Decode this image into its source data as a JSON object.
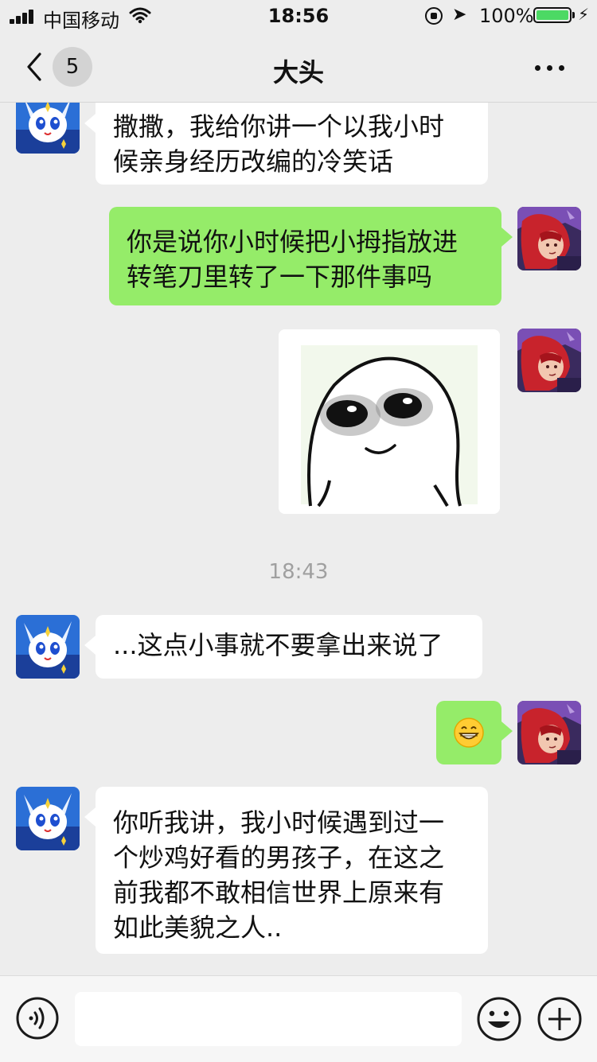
{
  "status_bar": {
    "carrier": "中国移动",
    "time": "18:56",
    "battery_percent": "100%",
    "battery_level": 1.0
  },
  "nav": {
    "unread_count": "5",
    "title": "大头"
  },
  "messages": [
    {
      "from": "friend",
      "avatar": "friend-avatar",
      "lines": [
        "撒撒，我给你讲一个以我小时",
        "候亲身经历改编的冷笑话"
      ]
    },
    {
      "from": "me",
      "avatar": "my-avatar",
      "lines": [
        "你是说你小时候把小拇指放进",
        "转笔刀里转了一下那件事吗"
      ]
    },
    {
      "from": "me",
      "avatar": "my-avatar",
      "sticker": "smiling-blob-sticker"
    },
    {
      "timestamp": "18:43"
    },
    {
      "from": "friend",
      "avatar": "friend-avatar",
      "lines": [
        "...这点小事就不要拿出来说了"
      ]
    },
    {
      "from": "me",
      "avatar": "my-avatar",
      "emoji": "grinning-emoji"
    },
    {
      "from": "friend",
      "avatar": "friend-avatar",
      "lines": [
        "你听我讲，我小时候遇到过一",
        "个炒鸡好看的男孩子，在这之",
        "前我都不敢相信世界上原来有",
        "如此美貌之人.."
      ]
    }
  ],
  "input_bar": {
    "value": "",
    "placeholder": "",
    "icons": [
      "voice-icon",
      "emoji-icon",
      "plus-icon"
    ]
  },
  "colors": {
    "background": "#ededed",
    "outgoing_bubble": "#95ec69",
    "incoming_bubble": "#ffffff",
    "battery_fill": "#4cd964"
  }
}
